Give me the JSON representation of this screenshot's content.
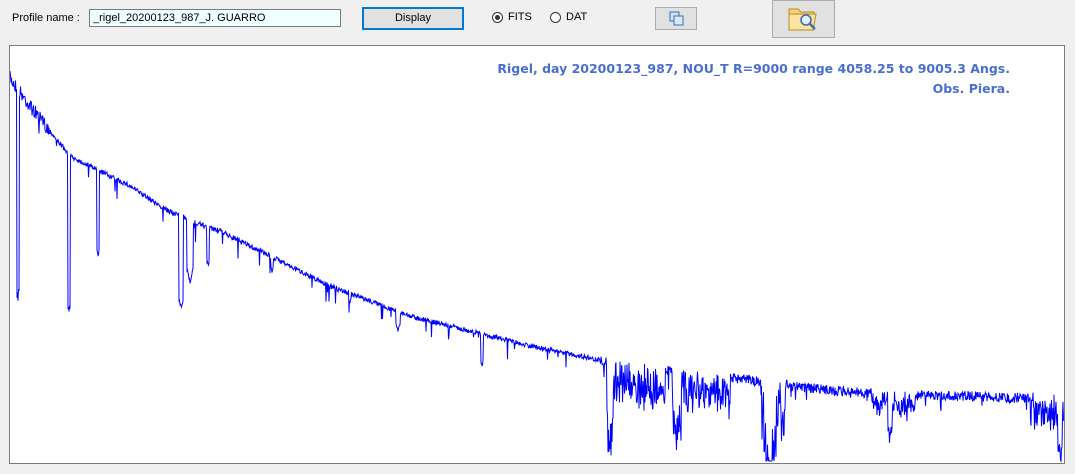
{
  "toolbar": {
    "profile_label": "Profile name :",
    "profile_value": "_rigel_20200123_987_J. GUARRO",
    "display_label": "Display",
    "format_options": [
      {
        "label": "FITS",
        "selected": true
      },
      {
        "label": "DAT",
        "selected": false
      }
    ],
    "copy_icon": "copy-icon",
    "open_icon": "folder-search-icon"
  },
  "spectrum": {
    "caption_line1": "Rigel,  day 20200123_987, NOU_T  R=9000 range 4058.25 to 9005.3  Angs.",
    "caption_line2": "Obs. Piera.",
    "wavelength_range": [
      4058.25,
      9005.3
    ],
    "line_color": "#0000ff",
    "caption_color": "#4a6fd0"
  }
}
